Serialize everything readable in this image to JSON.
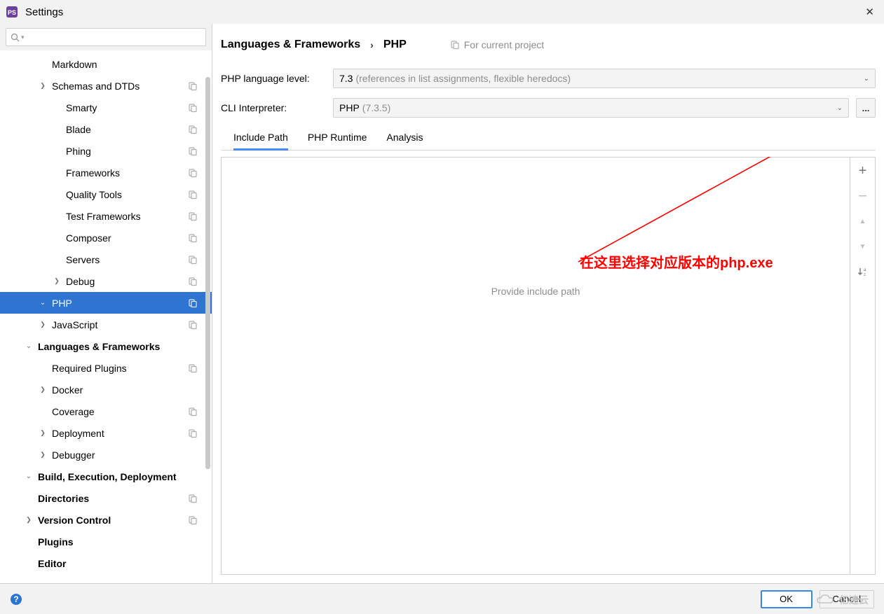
{
  "window": {
    "title": "Settings"
  },
  "search": {
    "placeholder": ""
  },
  "sidebar": [
    {
      "label": "Editor",
      "level": 1,
      "bold": true,
      "arrow": "",
      "proj": false
    },
    {
      "label": "Plugins",
      "level": 1,
      "bold": true,
      "arrow": "",
      "proj": false
    },
    {
      "label": "Version Control",
      "level": 1,
      "bold": true,
      "arrow": "right",
      "proj": true
    },
    {
      "label": "Directories",
      "level": 1,
      "bold": true,
      "arrow": "",
      "proj": true
    },
    {
      "label": "Build, Execution, Deployment",
      "level": 1,
      "bold": true,
      "arrow": "down",
      "proj": false
    },
    {
      "label": "Debugger",
      "level": 2,
      "bold": false,
      "arrow": "right",
      "proj": false
    },
    {
      "label": "Deployment",
      "level": 2,
      "bold": false,
      "arrow": "right",
      "proj": true
    },
    {
      "label": "Coverage",
      "level": 2,
      "bold": false,
      "arrow": "",
      "proj": true
    },
    {
      "label": "Docker",
      "level": 2,
      "bold": false,
      "arrow": "right",
      "proj": false
    },
    {
      "label": "Required Plugins",
      "level": 2,
      "bold": false,
      "arrow": "",
      "proj": true
    },
    {
      "label": "Languages & Frameworks",
      "level": 1,
      "bold": true,
      "arrow": "down",
      "proj": false
    },
    {
      "label": "JavaScript",
      "level": 2,
      "bold": false,
      "arrow": "right",
      "proj": true
    },
    {
      "label": "PHP",
      "level": 2,
      "bold": false,
      "arrow": "down",
      "proj": true,
      "selected": true
    },
    {
      "label": "Debug",
      "level": 3,
      "bold": false,
      "arrow": "right",
      "proj": true
    },
    {
      "label": "Servers",
      "level": 3,
      "bold": false,
      "arrow": "",
      "proj": true
    },
    {
      "label": "Composer",
      "level": 3,
      "bold": false,
      "arrow": "",
      "proj": true
    },
    {
      "label": "Test Frameworks",
      "level": 3,
      "bold": false,
      "arrow": "",
      "proj": true
    },
    {
      "label": "Quality Tools",
      "level": 3,
      "bold": false,
      "arrow": "",
      "proj": true
    },
    {
      "label": "Frameworks",
      "level": 3,
      "bold": false,
      "arrow": "",
      "proj": true
    },
    {
      "label": "Phing",
      "level": 3,
      "bold": false,
      "arrow": "",
      "proj": true
    },
    {
      "label": "Blade",
      "level": 3,
      "bold": false,
      "arrow": "",
      "proj": true
    },
    {
      "label": "Smarty",
      "level": 3,
      "bold": false,
      "arrow": "",
      "proj": true
    },
    {
      "label": "Schemas and DTDs",
      "level": 2,
      "bold": false,
      "arrow": "right",
      "proj": true
    },
    {
      "label": "Markdown",
      "level": 2,
      "bold": false,
      "arrow": "",
      "proj": false
    }
  ],
  "breadcrumb": {
    "crumb1": "Languages & Frameworks",
    "crumb2": "PHP",
    "note": "For current project"
  },
  "form": {
    "lang_level_label": "PHP language level:",
    "lang_level_value": "7.3",
    "lang_level_hint": "(references in list assignments, flexible heredocs)",
    "cli_label": "CLI Interpreter:",
    "cli_value": "PHP",
    "cli_hint": "(7.3.5)",
    "browse_label": "..."
  },
  "tabs": [
    "Include Path",
    "PHP Runtime",
    "Analysis"
  ],
  "active_tab": 0,
  "placeholder": "Provide include path",
  "tools": {
    "add": "+",
    "remove": "−",
    "up": "▲",
    "down": "▼",
    "sort": "↓ªᶻ"
  },
  "annotation": "在这里选择对应版本的php.exe",
  "footer": {
    "ok": "OK",
    "cancel": "Cancel"
  },
  "watermark": "亿速云"
}
